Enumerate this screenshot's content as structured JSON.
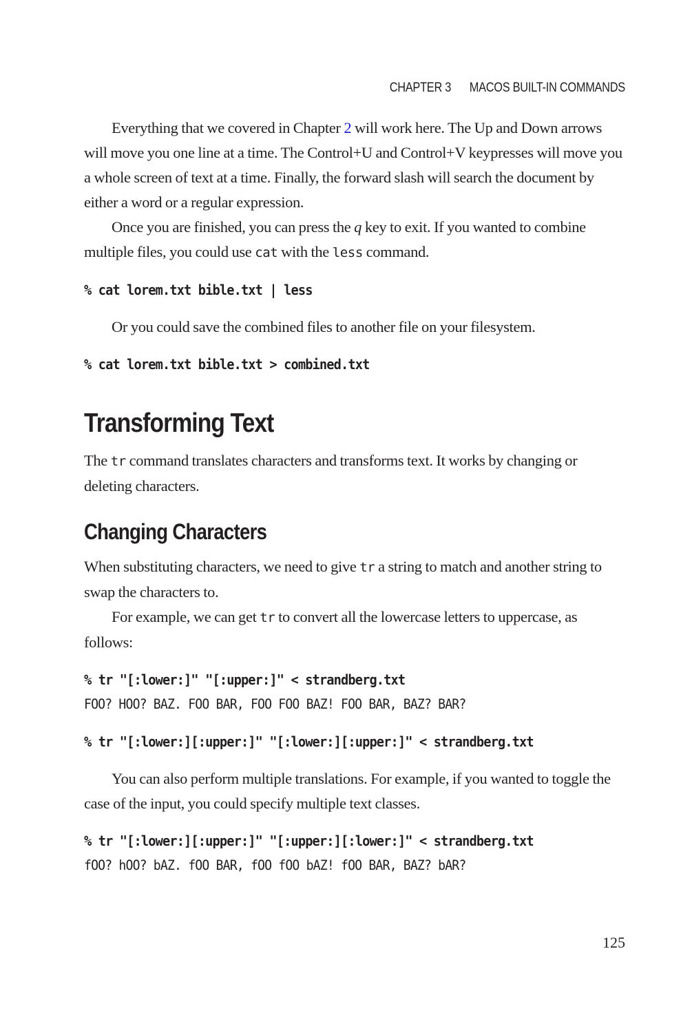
{
  "header": {
    "chapter_label": "CHAPTER 3",
    "chapter_title": "MACOS BUILT-IN COMMANDS"
  },
  "paragraphs": {
    "p1": {
      "before_link": "Everything that we covered in Chapter ",
      "link_text": "2",
      "after_link": " will work here. The Up and Down arrows will move you one line at a time. The Control+U and Control+V keypresses will move you a whole screen of text at a time. Finally, the forward slash will search the document by either a word or a regular expression."
    },
    "p2": {
      "part1": "Once you are finished, you can press the ",
      "italic_key": "q",
      "part2": " key to exit. If you wanted to combine multiple files, you could use ",
      "code1": "cat",
      "part3": " with the ",
      "code2": "less",
      "part4": " command."
    },
    "p3": "Or you could save the combined files to another file on your filesystem.",
    "p4": {
      "part1": "The ",
      "code": "tr",
      "part2": " command translates characters and transforms text. It works by changing or deleting characters."
    },
    "p5": {
      "part1": "When substituting characters, we need to give ",
      "code": "tr",
      "part2": " a string to match and another string to swap the characters to."
    },
    "p6": {
      "part1": "For example, we can get ",
      "code": "tr",
      "part2": " to convert all the lowercase letters to uppercase, as follows:"
    },
    "p7": "You can also perform multiple translations. For example, if you wanted to toggle the case of the input, you could specify multiple text classes."
  },
  "headings": {
    "section": "Transforming Text",
    "subsection": "Changing Characters"
  },
  "code": {
    "cmd1": "% cat lorem.txt bible.txt | less",
    "cmd2": "% cat lorem.txt bible.txt > combined.txt",
    "cmd3": "% tr \"[:lower:]\" \"[:upper:]\" < strandberg.txt",
    "out3": "FOO? HOO? BAZ. FOO BAR, FOO FOO BAZ! FOO BAR, BAZ? BAR?",
    "cmd4": "% tr \"[:lower:][:upper:]\" \"[:lower:][:upper:]\" < strandberg.txt",
    "cmd5": "% tr \"[:lower:][:upper:]\" \"[:upper:][:lower:]\" < strandberg.txt",
    "out5": "fOO? hOO? bAZ. fOO BAR, fOO fOO bAZ! fOO BAR, BAZ? bAR?"
  },
  "footer": {
    "page_number": "125"
  },
  "colors": {
    "text": "#231f20",
    "link": "#1a1acc"
  }
}
